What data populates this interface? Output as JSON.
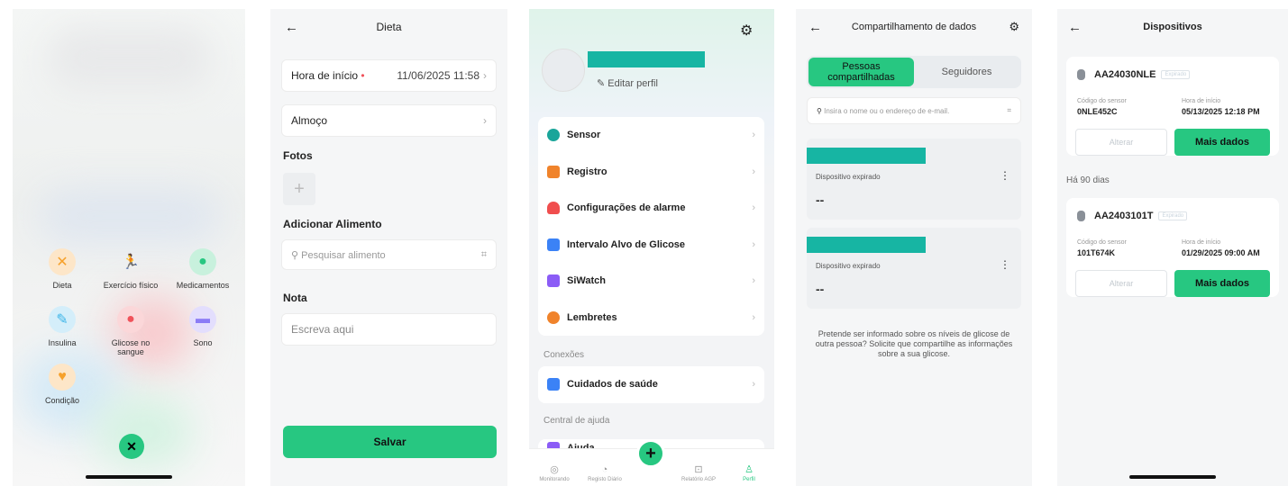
{
  "panel1": {
    "actions": [
      {
        "label": "Dieta",
        "icon": "fork-knife-icon",
        "color": "#f6a12b"
      },
      {
        "label": "Exercício físico",
        "icon": "runner-icon",
        "color": "#3b82f6"
      },
      {
        "label": "Medicamentos",
        "icon": "pill-icon",
        "color": "#27c781"
      },
      {
        "label": "Insulina",
        "icon": "syringe-icon",
        "color": "#3db5e8"
      },
      {
        "label": "Glicose no sangue",
        "icon": "droplet-icon",
        "color": "#f0525a"
      },
      {
        "label": "Sono",
        "icon": "bed-icon",
        "color": "#8b7cf6"
      },
      {
        "label": "Condição",
        "icon": "heart-icon",
        "color": "#f6a12b"
      }
    ],
    "close_icon": "✕"
  },
  "panel2": {
    "title": "Dieta",
    "start_label": "Hora de início",
    "required_mark": "•",
    "start_value": "11/06/2025 11:58",
    "meal_value": "Almoço",
    "photos_title": "Fotos",
    "add_food_title": "Adicionar Alimento",
    "search_placeholder": "Pesquisar alimento",
    "note_title": "Nota",
    "note_placeholder": "Escreva aqui",
    "save_label": "Salvar"
  },
  "panel3": {
    "edit_profile": "Editar perfil",
    "menu": [
      {
        "label": "Sensor",
        "color": "#1aa59a"
      },
      {
        "label": "Registro",
        "color": "#f0832b"
      },
      {
        "label": "Configurações de alarme",
        "color": "#f04e4e"
      },
      {
        "label": "Intervalo Alvo de Glicose",
        "color": "#3b82f6"
      },
      {
        "label": "SiWatch",
        "color": "#8b5cf6"
      },
      {
        "label": "Lembretes",
        "color": "#f0832b"
      }
    ],
    "connections_label": "Conexões",
    "connections": [
      {
        "label": "Cuidados de saúde",
        "color": "#3b82f6"
      }
    ],
    "help_label": "Central de ajuda",
    "help_item": "Ajuda",
    "tabs": [
      {
        "label": "Monitorando",
        "icon": "◎"
      },
      {
        "label": "Registo Diário",
        "icon": "◔"
      },
      {
        "label": "Relatório AGP",
        "icon": "⊡"
      },
      {
        "label": "Perfil",
        "icon": "♙"
      }
    ]
  },
  "panel4": {
    "title": "Compartilhamento de dados",
    "seg_on": "Pessoas compartilhadas",
    "seg_off": "Seguidores",
    "search_placeholder": "Insira o nome ou o endereço de e-mail.",
    "cards": [
      {
        "status": "Dispositivo expirado",
        "value": "--"
      },
      {
        "status": "Dispositivo expirado",
        "value": "--"
      }
    ],
    "info": "Pretende ser informado sobre os níveis de glicose de outra pessoa? Solicite que compartilhe as informações sobre a sua glicose."
  },
  "panel5": {
    "title": "Dispositivos",
    "days_label": "Há 90 dias",
    "devices": [
      {
        "name": "AA24030NLE",
        "badge": "Expirado",
        "sensor_label": "Código do sensor",
        "sensor_value": "0NLE452C",
        "start_label": "Hora de início",
        "start_value": "05/13/2025 12:18 PM",
        "alt": "Alterar",
        "more": "Mais dados"
      },
      {
        "name": "AA2403101T",
        "badge": "Expirado",
        "sensor_label": "Código do sensor",
        "sensor_value": "101T674K",
        "start_label": "Hora de início",
        "start_value": "01/29/2025 09:00 AM",
        "alt": "Alterar",
        "more": "Mais dados"
      }
    ]
  },
  "accent": "#27c781"
}
